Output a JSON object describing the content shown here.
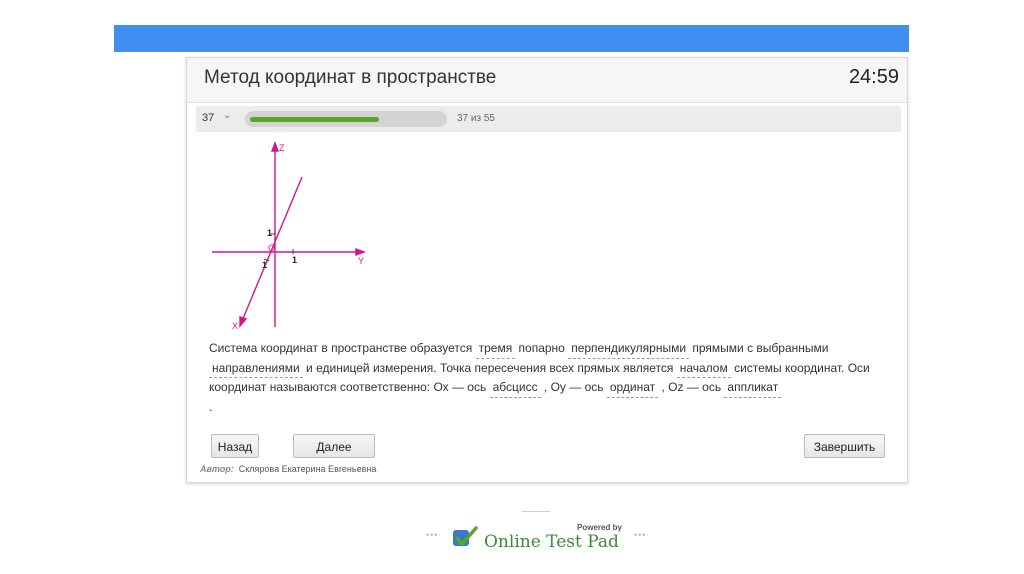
{
  "window": {
    "title": "Метод координат в пространстве",
    "timer": "24:59"
  },
  "progress": {
    "current": "37",
    "counter_text": "37 из 55",
    "fraction": 0.6727
  },
  "figure": {
    "axis_z": "Z",
    "axis_y": "Y",
    "axis_x": "X",
    "origin": "O",
    "tick_z": "1",
    "tick_y": "1",
    "tick_x": "1"
  },
  "question": {
    "p1": "Система координат в пространстве образуется ",
    "b1": "тремя",
    "p2": " попарно ",
    "b2": "перпендикулярными",
    "p3": " прямыми с выбранными ",
    "b3": "направлениями",
    "p4": " и единицей измерения. Точка пересечения всех прямых является ",
    "b4": "началом",
    "p5": " системы координат. Оси координат называются соответственно: Ох — ось ",
    "b5": "абсцисс",
    "p6": " , Оу — ось ",
    "b6": "ординат",
    "p7": " , Oz — ось ",
    "b7": "аппликат",
    "p8": " ."
  },
  "buttons": {
    "back": "Назад",
    "next": "Далее",
    "finish": "Завершить"
  },
  "author": {
    "label": "Автор:",
    "name": "Склярова Екатерина Евгеньевна"
  },
  "footer": {
    "powered_by": "Powered by",
    "brand": "Online Test Pad",
    "dots": "•••"
  },
  "colors": {
    "topbar": "#3f8ff0",
    "progress_fill": "#5aa52a",
    "axis": "#d6148c"
  }
}
